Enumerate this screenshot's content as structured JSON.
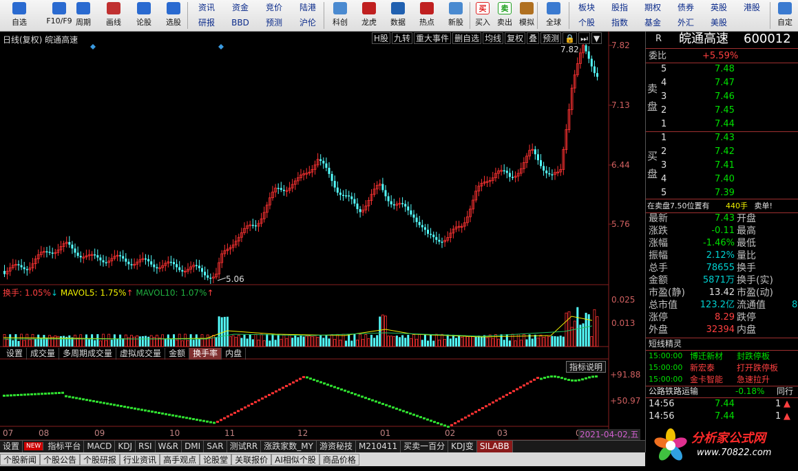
{
  "toolbar": {
    "big": [
      {
        "label": "自选",
        "icon": "star-icon",
        "color": "#2a6ad0"
      },
      {
        "label": "F10/F9",
        "icon": "f10-icon",
        "color": "#2a6ad0"
      },
      {
        "label": "周期",
        "icon": "clock-icon",
        "color": "#2a6ad0"
      },
      {
        "label": "画线",
        "icon": "pen-icon",
        "color": "#c03030"
      },
      {
        "label": "论股",
        "icon": "lungu-icon",
        "color": "#2a6ad0"
      },
      {
        "label": "选股",
        "icon": "pick-icon",
        "color": "#2a6ad0"
      }
    ],
    "small_left": [
      [
        "资讯",
        "资金",
        "竞价",
        "陆港"
      ],
      [
        "研报",
        "BBD",
        "预测",
        "沪伦"
      ]
    ],
    "big2": [
      {
        "label": "科创",
        "icon": "kechuang-icon",
        "color": "#4a8ad0"
      },
      {
        "label": "龙虎",
        "icon": "dragon-icon",
        "color": "#c02020"
      },
      {
        "label": "数据",
        "icon": "pe-icon",
        "color": "#2060b0"
      },
      {
        "label": "热点",
        "icon": "hot-icon",
        "color": "#c02020"
      },
      {
        "label": "新股",
        "icon": "ipo-icon",
        "color": "#4a8ad0"
      }
    ],
    "trade": [
      {
        "label": "买入",
        "icon": "buy-icon",
        "glyph": "买",
        "color": "#e02020"
      },
      {
        "label": "卖出",
        "icon": "sell-icon",
        "glyph": "卖",
        "color": "#20a020"
      },
      {
        "label": "模拟",
        "icon": "hammer-icon",
        "glyph": "",
        "color": "#b07020"
      }
    ],
    "globe": {
      "label": "全球",
      "icon": "globe-icon"
    },
    "small_right": [
      [
        "板块",
        "股指",
        "期权",
        "债券",
        "英股",
        "港股"
      ],
      [
        "个股",
        "指数",
        "基金",
        "外汇",
        "美股"
      ]
    ],
    "last": {
      "label": "自定",
      "icon": "custom-icon"
    }
  },
  "chart": {
    "title": "日线(复权) 皖通高速",
    "top_buttons": [
      "H股",
      "九转",
      "重大事件",
      "删自选",
      "均线",
      "复权",
      "叠",
      "预测",
      "🔒",
      "⏭",
      "▼"
    ],
    "price_axis": [
      "7.82",
      "7.13",
      "6.44",
      "5.76"
    ],
    "high_label": "7.82",
    "low_label": "5.06",
    "vol_header": {
      "name": "换手:",
      "value": "1.05%",
      "arrow": "↓",
      "ma5_label": "MAVOL5:",
      "ma5_value": "1.75%",
      "ma10_label": "MAVOL10:",
      "ma10_value": "1.07%"
    },
    "vol_axis": [
      "0.025",
      "0.013"
    ],
    "tabs": [
      "设置",
      "成交量",
      "多周期成交量",
      "虚拟成交量",
      "金额",
      "换手率",
      "内盘"
    ],
    "active_tab": "换手率",
    "indicator_button": "指标说明",
    "ind_axis": [
      "+91.88",
      "+50.97"
    ],
    "months": [
      "07",
      "08",
      "09",
      "10",
      "11",
      "12",
      "01",
      "02",
      "03",
      "0"
    ],
    "date_badge": "2021-04-02,五"
  },
  "bottom_tabs": [
    "设置",
    "NEW",
    "指标平台",
    "MACD",
    "KDJ",
    "RSI",
    "W&R",
    "DMI",
    "SAR",
    "测试RR",
    "涨跌家数_MY",
    "游资秘技",
    "M210411",
    "买卖一百分",
    "KDJ变",
    "SILABB"
  ],
  "bottom_tabs_active": "SILABB",
  "bottom_tabs2": [
    "个股新闻",
    "个股公告",
    "个股研报",
    "行业资讯",
    "高手观点",
    "论股堂",
    "关联报价",
    "AI相似个股",
    "商品价格"
  ],
  "side": {
    "r": "R",
    "name": "皖通高速",
    "code": "600012",
    "weibi_label": "委比",
    "weibi": "+5.59%",
    "sell_label": "卖\n盘",
    "buy_label": "买\n盘",
    "sell": [
      {
        "n": "5",
        "p": "7.48"
      },
      {
        "n": "4",
        "p": "7.47"
      },
      {
        "n": "3",
        "p": "7.46"
      },
      {
        "n": "2",
        "p": "7.45"
      },
      {
        "n": "1",
        "p": "7.44"
      }
    ],
    "buy": [
      {
        "n": "1",
        "p": "7.43"
      },
      {
        "n": "2",
        "p": "7.42"
      },
      {
        "n": "3",
        "p": "7.41"
      },
      {
        "n": "4",
        "p": "7.40"
      },
      {
        "n": "5",
        "p": "7.39"
      }
    ],
    "notice": {
      "a": "在卖盘",
      "b": "7.50",
      "c": "位置有",
      "d": "440手",
      "e": "卖单!"
    },
    "quotes": [
      {
        "k": "最新",
        "v": "7.43",
        "vc": "grn",
        "k2": "开盘"
      },
      {
        "k": "涨跌",
        "v": "-0.11",
        "vc": "grn",
        "k2": "最高"
      },
      {
        "k": "涨幅",
        "v": "-1.46%",
        "vc": "grn",
        "k2": "最低"
      },
      {
        "k": "振幅",
        "v": "2.12%",
        "vc": "cyn",
        "k2": "量比"
      },
      {
        "k": "总手",
        "v": "78655",
        "vc": "cyn",
        "k2": "换手"
      },
      {
        "k": "金额",
        "v": "5871万",
        "vc": "cyn",
        "k2": "换手(实)"
      },
      {
        "k": "市盈(静)",
        "v": "13.42",
        "vc": "wht",
        "k2": "市盈(动)"
      },
      {
        "k": "总市值",
        "v": "123.2亿",
        "vc": "cyn",
        "k2": "流通值",
        "v2": "8"
      },
      {
        "k": "涨停",
        "v": "8.29",
        "vc": "red",
        "k2": "跌停"
      },
      {
        "k": "外盘",
        "v": "32394",
        "vc": "red",
        "k2": "内盘"
      }
    ],
    "news_title": "短线精灵",
    "news": [
      {
        "t": "15:00:00",
        "s": "博迁新材",
        "e": "封跌停板",
        "sc": "grn",
        "ec": "grn"
      },
      {
        "t": "15:00:00",
        "s": "新宏泰",
        "e": "打开跌停板",
        "sc": "red",
        "ec": "red"
      },
      {
        "t": "15:00:00",
        "s": "金卡智能",
        "e": "急速拉升",
        "sc": "red",
        "ec": "red"
      }
    ],
    "sector": {
      "name": "公路铁路运输",
      "pct": "-0.18%",
      "tail": "同行"
    },
    "ticks": [
      {
        "t": "14:56",
        "p": "7.44",
        "n": "1"
      },
      {
        "t": "14:56",
        "p": "7.44",
        "n": "1"
      }
    ]
  },
  "logo": {
    "title": "分析家公式网",
    "url": "www.70822.com"
  }
}
